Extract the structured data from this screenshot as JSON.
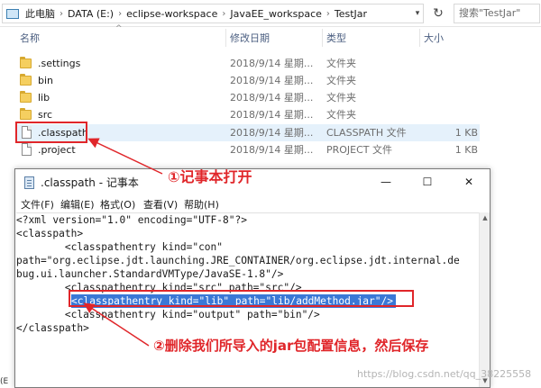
{
  "address_bar": {
    "crumbs": [
      "此电脑",
      "DATA (E:)",
      "eclipse-workspace",
      "JavaEE_workspace",
      "TestJar"
    ],
    "search_placeholder": "搜索\"TestJar\""
  },
  "columns": {
    "name": "名称",
    "date": "修改日期",
    "type": "类型",
    "size": "大小"
  },
  "files": [
    {
      "name": ".settings",
      "date": "2018/9/14 星期...",
      "type": "文件夹",
      "size": "",
      "icon": "folder-icon"
    },
    {
      "name": "bin",
      "date": "2018/9/14 星期...",
      "type": "文件夹",
      "size": "",
      "icon": "folder-icon"
    },
    {
      "name": "lib",
      "date": "2018/9/14 星期...",
      "type": "文件夹",
      "size": "",
      "icon": "folder-icon"
    },
    {
      "name": "src",
      "date": "2018/9/14 星期...",
      "type": "文件夹",
      "size": "",
      "icon": "folder-icon"
    },
    {
      "name": ".classpath",
      "date": "2018/9/14 星期...",
      "type": "CLASSPATH 文件",
      "size": "1 KB",
      "icon": "file-icon",
      "selected": true
    },
    {
      "name": ".project",
      "date": "2018/9/14 星期...",
      "type": "PROJECT 文件",
      "size": "1 KB",
      "icon": "file-icon"
    }
  ],
  "notepad": {
    "title": ".classpath - 记事本",
    "menu": [
      "文件(F)",
      "编辑(E)",
      "格式(O)",
      "查看(V)",
      "帮助(H)"
    ],
    "lines": [
      "<?xml version=\"1.0\" encoding=\"UTF-8\"?>",
      "<classpath>",
      "        <classpathentry kind=\"con\"",
      "path=\"org.eclipse.jdt.launching.JRE_CONTAINER/org.eclipse.jdt.internal.de",
      "bug.ui.launcher.StandardVMType/JavaSE-1.8\"/>",
      "        <classpathentry kind=\"src\" path=\"src\"/>",
      "<classpathentry kind=\"lib\" path=\"lib/addMethod.jar\"/>",
      "        <classpathentry kind=\"output\" path=\"bin\"/>",
      "</classpath>"
    ]
  },
  "annotations": {
    "step1": "①记事本打开",
    "step2": "②删除我们所导入的jar包配置信息，然后保存",
    "color": "#e0262a"
  },
  "watermark": "https://blog.csdn.net/qq_38225558",
  "left_edge_mark": "(E"
}
